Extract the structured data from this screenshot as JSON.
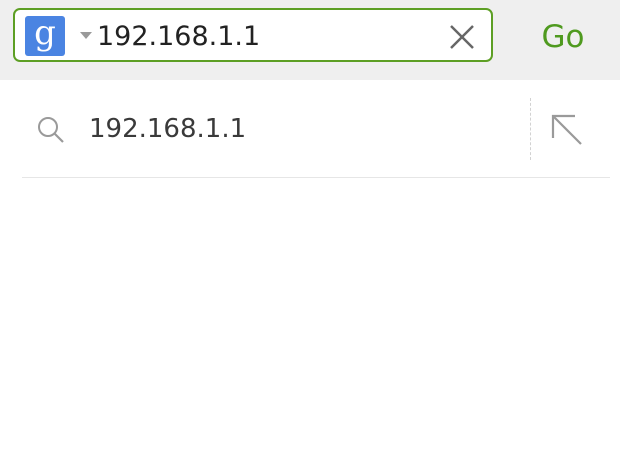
{
  "search_bar": {
    "engine_logo_letter": "g",
    "engine_icon": "google-logo-icon",
    "query_value": "192.168.1.1",
    "clear_icon": "close-icon",
    "go_label": "Go"
  },
  "suggestions": [
    {
      "icon": "search-icon",
      "text": "192.168.1.1",
      "action_icon": "arrow-up-left-icon"
    }
  ],
  "colors": {
    "accent_green": "#5d9f24",
    "go_text": "#4f9a1f",
    "engine_blue": "#4a84e2",
    "top_bar_bg": "#efefef"
  }
}
